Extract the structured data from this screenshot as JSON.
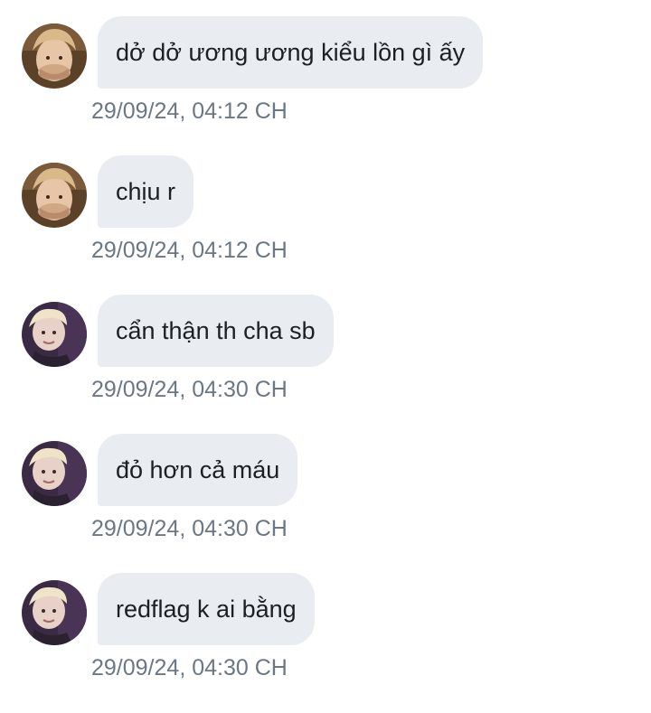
{
  "conversation": {
    "messages": [
      {
        "sender_avatar": "avatar-user-a",
        "text": "dở dở ương ương kiểu lồn gì ấy",
        "timestamp": "29/09/24, 04:12 CH"
      },
      {
        "sender_avatar": "avatar-user-a",
        "text": "chịu r",
        "timestamp": "29/09/24, 04:12 CH"
      },
      {
        "sender_avatar": "avatar-user-b",
        "text": "cẩn thận th cha sb",
        "timestamp": "29/09/24, 04:30 CH"
      },
      {
        "sender_avatar": "avatar-user-b",
        "text": "đỏ hơn cả máu",
        "timestamp": "29/09/24, 04:30 CH"
      },
      {
        "sender_avatar": "avatar-user-b",
        "text": "redflag k ai bằng",
        "timestamp": "29/09/24, 04:30 CH"
      }
    ]
  },
  "colors": {
    "bubble_background": "#e9edf2",
    "message_text": "#1c1f23",
    "timestamp_text": "#6b7785",
    "page_background": "#ffffff"
  }
}
